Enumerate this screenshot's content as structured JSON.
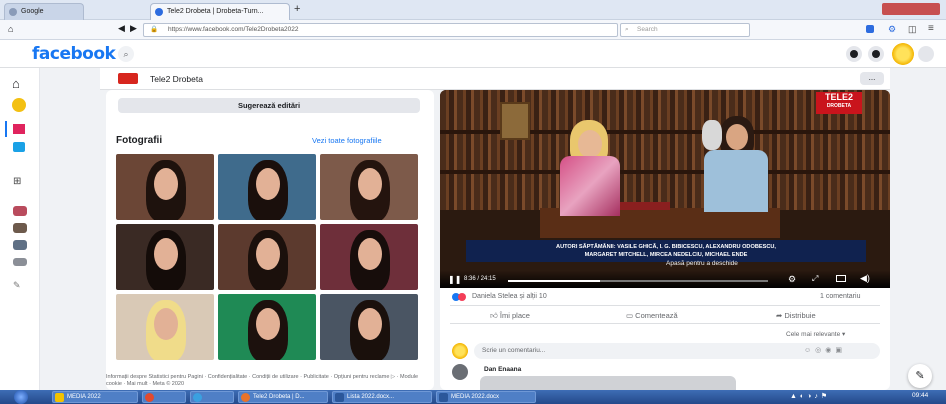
{
  "browser": {
    "tabs": [
      {
        "label": "Google"
      },
      {
        "label": "Tele2 Drobeta | Drobeta-Turn..."
      }
    ],
    "url": "https://www.facebook.com/Tele2Drobeta2022",
    "search_placeholder": "Search",
    "new_tab_symbol": "+"
  },
  "facebook": {
    "logo": "facebook",
    "page_name": "Tele2 Drobeta",
    "more_symbol": "..."
  },
  "left_card": {
    "suggest_edits": "Sugerează editări",
    "photos_title": "Fotografii",
    "see_all": "Vezi toate fotografiile",
    "footer": "Informații despre Statistici pentru Pagini · Confidențialitate · Condiții de utilizare · Publicitate · Opțiuni pentru reclame ▷ · Module cookie · Mai mult · Meta © 2020"
  },
  "video": {
    "brand_logo": "TELE2",
    "brand_sub": "DROBETA",
    "caption_line1": "AUTORI SĂPTĂMÂNII: VASILE GHICĂ, I. G. BIBICESCU, ALEXANDRU ODOBESCU,",
    "caption_line2": "MARGARET MITCHELL, MIRCEA NEDELCIU, MICHAEL ENDE",
    "tooltip": "Apasă pentru a deschide",
    "time": "8:36 / 24:15"
  },
  "post": {
    "reactions": "Daniela Stelea și alții 10",
    "comments_count": "1 comentariu",
    "like": "Îmi place",
    "comment": "Comentează",
    "share": "Distribuie",
    "sort": "Cele mai relevante ▾",
    "comment_placeholder": "Scrie un comentariu...",
    "commenter": "Dan Enaana"
  },
  "taskbar": {
    "items": [
      {
        "label": "MEDIA 2022"
      },
      {
        "label": ""
      },
      {
        "label": ""
      },
      {
        "label": "Tele2 Drobeta | D..."
      },
      {
        "label": "Lista 2022.docx..."
      },
      {
        "label": "MEDIA 2022.docx"
      }
    ],
    "clock": "09:44"
  },
  "colors": {
    "fb_blue": "#1877f2",
    "taskbar": "#2a5296",
    "video_bg": "#3a2418"
  }
}
